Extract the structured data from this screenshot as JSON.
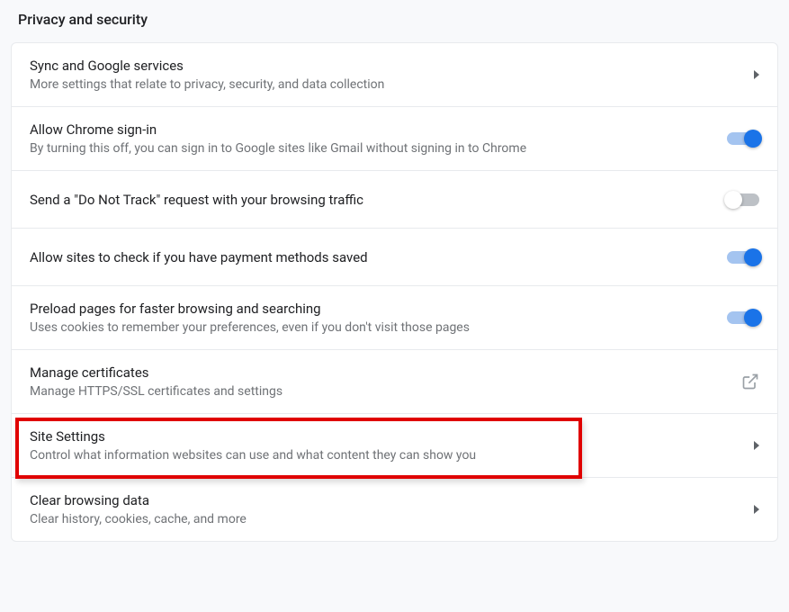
{
  "section_title": "Privacy and security",
  "rows": [
    {
      "id": "sync",
      "title": "Sync and Google services",
      "subtitle": "More settings that relate to privacy, security, and data collection",
      "control": "chevron"
    },
    {
      "id": "signin",
      "title": "Allow Chrome sign-in",
      "subtitle": "By turning this off, you can sign in to Google sites like Gmail without signing in to Chrome",
      "control": "toggle",
      "toggle_state": "on"
    },
    {
      "id": "dnt",
      "title": "Send a \"Do Not Track\" request with your browsing traffic",
      "subtitle": "",
      "control": "toggle",
      "toggle_state": "off"
    },
    {
      "id": "payment",
      "title": "Allow sites to check if you have payment methods saved",
      "subtitle": "",
      "control": "toggle",
      "toggle_state": "on"
    },
    {
      "id": "preload",
      "title": "Preload pages for faster browsing and searching",
      "subtitle": "Uses cookies to remember your preferences, even if you don't visit those pages",
      "control": "toggle",
      "toggle_state": "on"
    },
    {
      "id": "certificates",
      "title": "Manage certificates",
      "subtitle": "Manage HTTPS/SSL certificates and settings",
      "control": "external"
    },
    {
      "id": "site-settings",
      "title": "Site Settings",
      "subtitle": "Control what information websites can use and what content they can show you",
      "control": "chevron",
      "highlighted": true
    },
    {
      "id": "clear-data",
      "title": "Clear browsing data",
      "subtitle": "Clear history, cookies, cache, and more",
      "control": "chevron"
    }
  ],
  "colors": {
    "accent": "#1a73e8",
    "highlight_border": "#e00000"
  }
}
